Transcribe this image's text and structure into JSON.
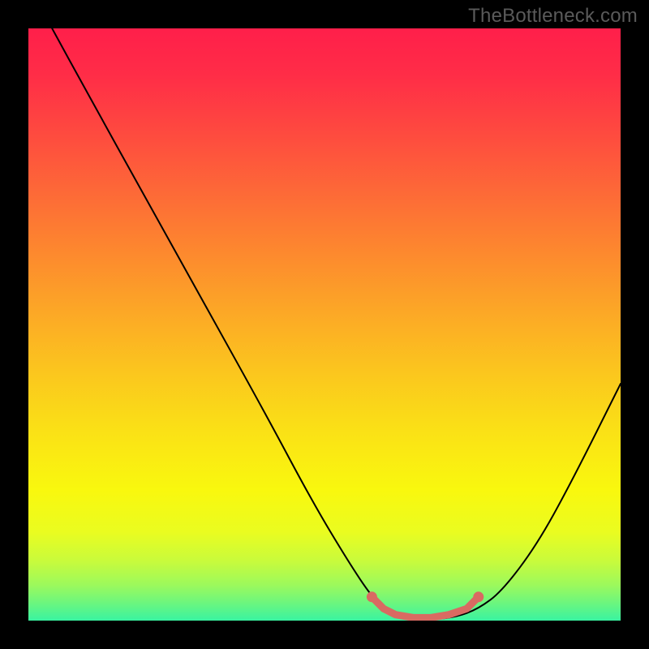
{
  "watermark": "TheBottleneck.com",
  "gradient": {
    "stops": [
      {
        "offset": 0.0,
        "color": "#ff1f4a"
      },
      {
        "offset": 0.08,
        "color": "#ff2d47"
      },
      {
        "offset": 0.18,
        "color": "#fe4b3f"
      },
      {
        "offset": 0.28,
        "color": "#fd6a37"
      },
      {
        "offset": 0.38,
        "color": "#fd892e"
      },
      {
        "offset": 0.48,
        "color": "#fca826"
      },
      {
        "offset": 0.58,
        "color": "#fbc61e"
      },
      {
        "offset": 0.68,
        "color": "#fae116"
      },
      {
        "offset": 0.78,
        "color": "#f9f80e"
      },
      {
        "offset": 0.85,
        "color": "#eafc20"
      },
      {
        "offset": 0.9,
        "color": "#c8fb3c"
      },
      {
        "offset": 0.94,
        "color": "#9cf95c"
      },
      {
        "offset": 0.97,
        "color": "#6cf67e"
      },
      {
        "offset": 1.0,
        "color": "#39f3a1"
      }
    ]
  },
  "chart_data": {
    "type": "line",
    "title": "",
    "xlabel": "",
    "ylabel": "",
    "x_range": [
      0,
      100
    ],
    "y_range": [
      0,
      100
    ],
    "series": [
      {
        "name": "bottleneck-curve",
        "color": "#000000",
        "points": [
          {
            "x": 4,
            "y": 100
          },
          {
            "x": 10,
            "y": 89
          },
          {
            "x": 20,
            "y": 71
          },
          {
            "x": 30,
            "y": 53
          },
          {
            "x": 40,
            "y": 35
          },
          {
            "x": 48,
            "y": 20
          },
          {
            "x": 54,
            "y": 10
          },
          {
            "x": 58,
            "y": 4
          },
          {
            "x": 61,
            "y": 1
          },
          {
            "x": 66,
            "y": 0
          },
          {
            "x": 72,
            "y": 0.5
          },
          {
            "x": 76,
            "y": 2
          },
          {
            "x": 80,
            "y": 5
          },
          {
            "x": 86,
            "y": 13
          },
          {
            "x": 92,
            "y": 24
          },
          {
            "x": 100,
            "y": 40
          }
        ]
      },
      {
        "name": "optimal-range-marker",
        "color": "#d96a62",
        "style": "thick-dots",
        "points": [
          {
            "x": 58,
            "y": 4
          },
          {
            "x": 60,
            "y": 2
          },
          {
            "x": 62,
            "y": 1
          },
          {
            "x": 65,
            "y": 0.5
          },
          {
            "x": 68,
            "y": 0.5
          },
          {
            "x": 71,
            "y": 1
          },
          {
            "x": 74,
            "y": 2
          },
          {
            "x": 76,
            "y": 4
          }
        ]
      }
    ]
  }
}
